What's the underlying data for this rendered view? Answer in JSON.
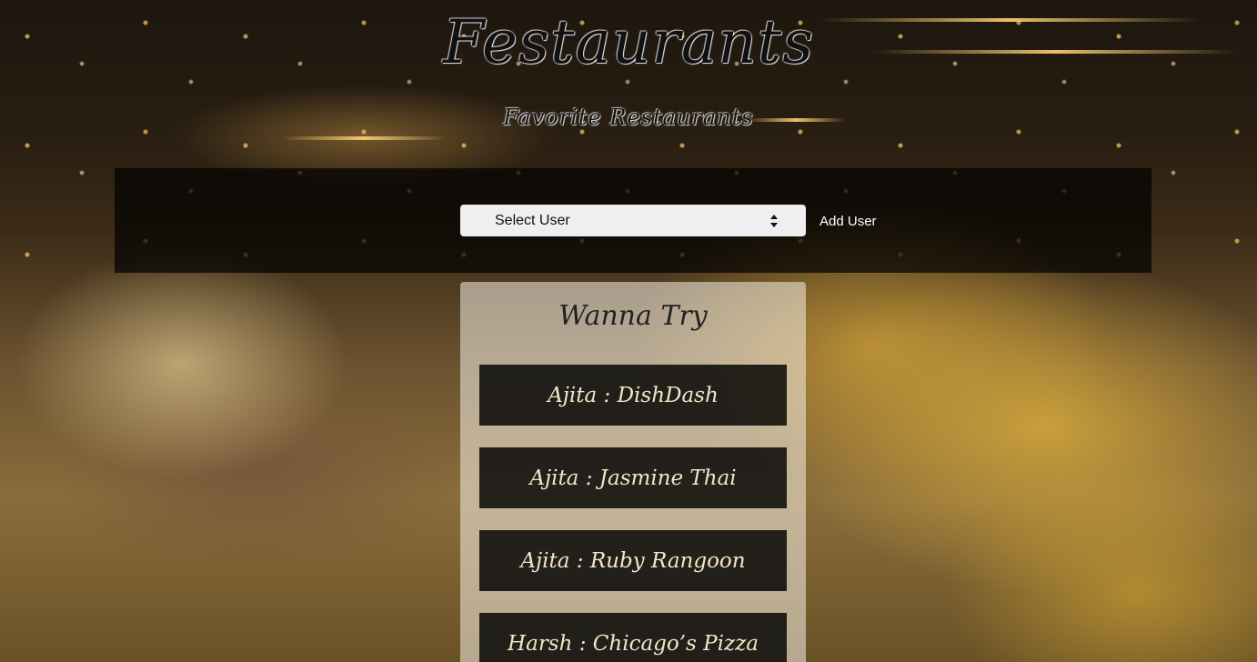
{
  "header": {
    "title": "Festaurants",
    "subtitle": "Favorite Restaurants"
  },
  "toolbar": {
    "select_label": "Select User",
    "add_user_label": "Add User"
  },
  "wanna_try": {
    "title": "Wanna Try",
    "items": [
      {
        "label": "Ajita : DishDash"
      },
      {
        "label": "Ajita : Jasmine Thai"
      },
      {
        "label": "Ajita : Ruby Rangoon"
      },
      {
        "label": "Harsh : Chicago’s Pizza"
      }
    ]
  },
  "colors": {
    "toolbar_bg": "#000000",
    "item_bg": "#000000",
    "item_text": "#f3e6c4",
    "panel_bg": "#f5f0e6"
  }
}
